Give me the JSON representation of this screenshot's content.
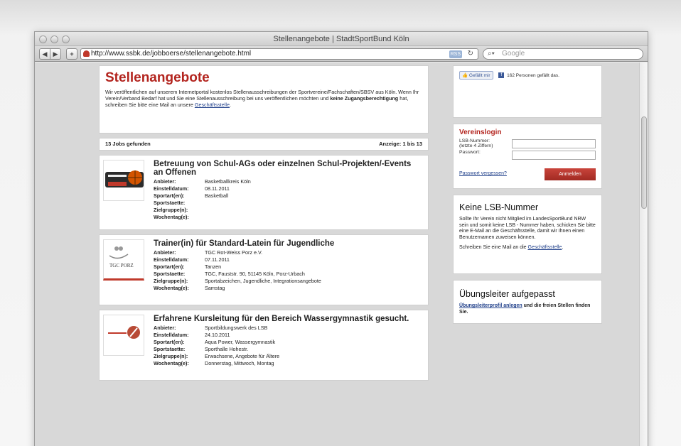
{
  "window": {
    "title": "Stellenangebote | StadtSportBund Köln"
  },
  "toolbar": {
    "url": "http://www.ssbk.de/jobboerse/stellenangebote.html",
    "rss_label": "RSS",
    "search_placeholder": "Google"
  },
  "hero": {
    "title": "Stellenangebote",
    "text_before": "Wir veröffentlichen auf unserem Internetportal kostenlos Stellenausschreibungen der Sportvereine/Fachschaften/SBSV aus Köln. Wenn Ihr Verein/Verband Bedarf hat und Sie eine Stellenausschreibung bei uns veröffentlichen möchten und ",
    "bold_text": "keine Zugangsberechtigung",
    "text_after": " hat, schreiben Sie bitte eine Mail an unsere ",
    "link": "Geschäftsstelle",
    "end": "."
  },
  "results": {
    "count": "13 Jobs gefunden",
    "range": "Anzeige: 1 bis 13"
  },
  "labels": {
    "anbieter": "Anbieter:",
    "datum": "Einstelldatum:",
    "sportart": "Sportart(en):",
    "staette": "Sportstaette:",
    "zielgruppe": "Zielgruppe(n):",
    "wochentag": "Wochentag(e):"
  },
  "jobs": [
    {
      "title": "Betreuung von Schul-AGs oder einzelnen Schul-Projekten/-Events an Offenen",
      "anbieter": "Basketballkreis Köln",
      "datum": "08.11.2011",
      "sportart": "Basketball",
      "staette": "",
      "zielgruppe": "",
      "wochentag": ""
    },
    {
      "title": "Trainer(in) für Standard-Latein für Jugendliche",
      "anbieter": "TGC Rot-Weiss Porz e.V.",
      "datum": "07.11.2011",
      "sportart": "Tanzen",
      "staette": "TGC, Fauststr. 90, 51145 Köln, Porz-Urbach",
      "zielgruppe": "Sportabzeichen, Jugendliche, Integrationsangebote",
      "wochentag": "Samstag",
      "logo_text": "TGC PORZ"
    },
    {
      "title": "Erfahrene Kursleitung für den Bereich Wassergymnastik gesucht.",
      "anbieter": "Sportbildungswerk des LSB",
      "datum": "24.10.2011",
      "sportart": "Aqua Power, Wassergymnastik",
      "staette": "Sporthalle Hohestr.",
      "zielgruppe": "Erwachsene, Angebote für Ältere",
      "wochentag": "Donnerstag, Mittwoch, Montag"
    }
  ],
  "facebook": {
    "button": "Gefällt mir",
    "count_text": "162 Personen gefällt das."
  },
  "login": {
    "title": "Vereinslogin",
    "lsb_label_1": "LSB-Nummer:",
    "lsb_label_2": "(letzte 4 Ziffern)",
    "pw_label": "Passwort:",
    "forgot": "Passwort vergessen?",
    "submit": "Anmelden"
  },
  "keine": {
    "title": "Keine LSB-Nummer",
    "text": "Sollte Ihr Verein nicht Mitglied im LandesSportBund NRW sein und somit keine LSB - Nummer haben, schicken Sie bitte eine E-Mail an die Geschäftsstelle, damit wir Ihnen einen Benutzernamen zuweisen können.",
    "mail_text": "Schreiben Sie eine Mail an die ",
    "mail_link": "Geschäftsstelle",
    "end": "."
  },
  "uebung": {
    "title": "Übungsleiter aufgepasst",
    "link": "Übungsleiterprofil anlegen",
    "text": " und die freien Stellen finden Sie."
  },
  "colors": {
    "accent": "#b3241e",
    "link": "#1f3f8a"
  }
}
